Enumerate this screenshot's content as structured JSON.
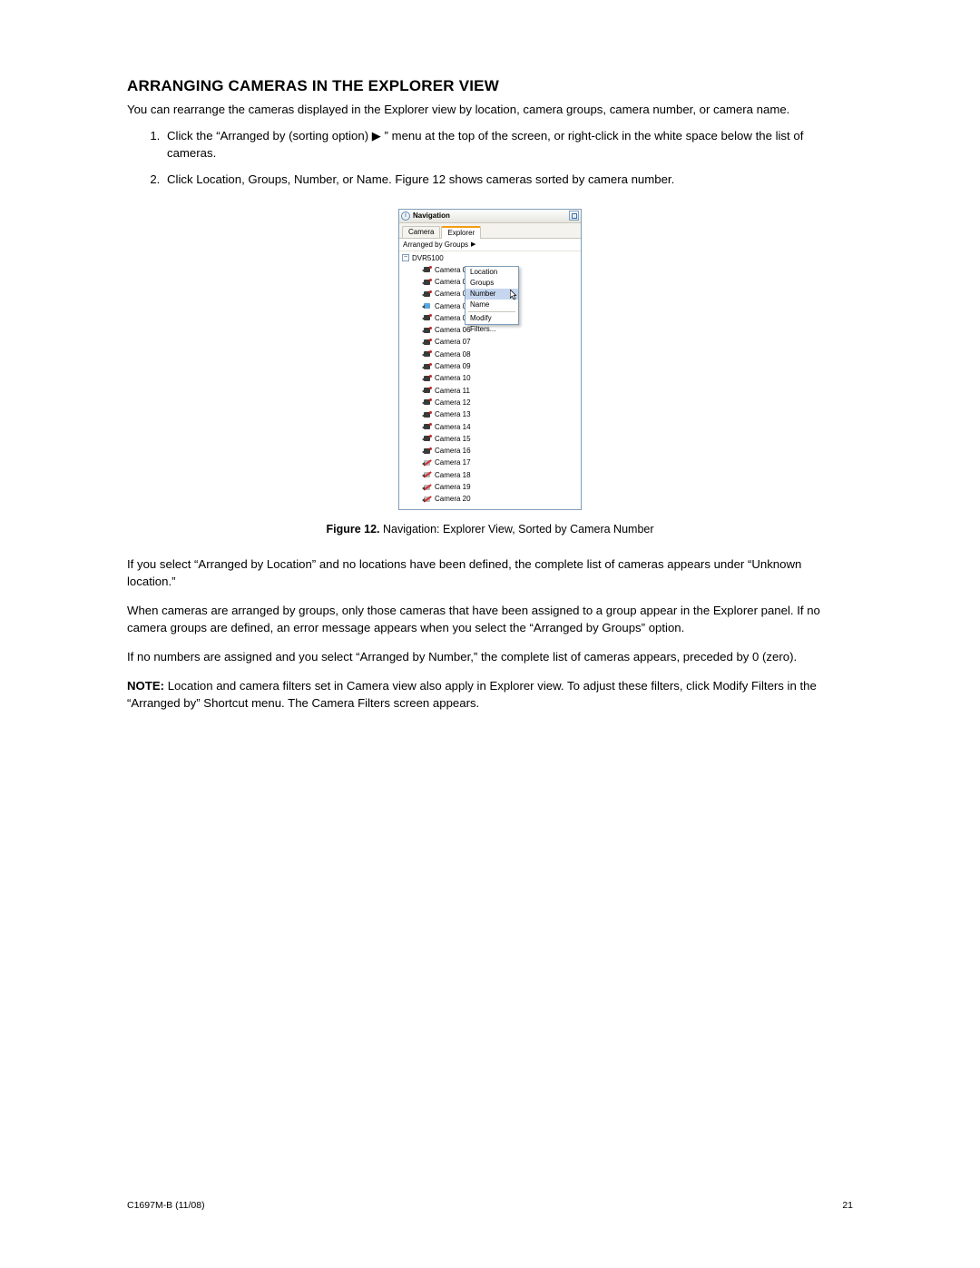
{
  "heading": "ARRANGING CAMERAS IN THE EXPLORER VIEW",
  "intro": "You can rearrange the cameras displayed in the Explorer view by location, camera groups, camera number, or camera name.",
  "steps": [
    "Click the “Arranged by  (sorting option) ▶ ” menu at the top of the screen, or right-click in the white space below the list of cameras.",
    "Click Location, Groups, Number, or Name. Figure 12 shows cameras sorted by camera number."
  ],
  "panel": {
    "title": "Navigation",
    "tabs": {
      "camera": "Camera",
      "explorer": "Explorer"
    },
    "arranged_label": "Arranged by Groups",
    "root": "DVR5100",
    "cameras": [
      {
        "label": "Camera 01",
        "state": "on"
      },
      {
        "label": "Camera 02",
        "state": "on"
      },
      {
        "label": "Camera 03",
        "state": "on"
      },
      {
        "label": "Camera 04",
        "state": "sel"
      },
      {
        "label": "Camera 05",
        "state": "on"
      },
      {
        "label": "Camera 06",
        "state": "on"
      },
      {
        "label": "Camera 07",
        "state": "on"
      },
      {
        "label": "Camera 08",
        "state": "on"
      },
      {
        "label": "Camera 09",
        "state": "on"
      },
      {
        "label": "Camera 10",
        "state": "on"
      },
      {
        "label": "Camera 11",
        "state": "on"
      },
      {
        "label": "Camera 12",
        "state": "on"
      },
      {
        "label": "Camera 13",
        "state": "on"
      },
      {
        "label": "Camera 14",
        "state": "on"
      },
      {
        "label": "Camera 15",
        "state": "on"
      },
      {
        "label": "Camera 16",
        "state": "on"
      },
      {
        "label": "Camera 17",
        "state": "off"
      },
      {
        "label": "Camera 18",
        "state": "off"
      },
      {
        "label": "Camera 19",
        "state": "off"
      },
      {
        "label": "Camera 20",
        "state": "off"
      }
    ],
    "menu": {
      "location": "Location",
      "groups": "Groups",
      "number": "Number",
      "name": "Name",
      "modify": "Modify Filters..."
    }
  },
  "caption": {
    "bold": "Figure 12.",
    "rest": "  Navigation: Explorer View, Sorted by Camera Number"
  },
  "paragraphs": [
    "If you select “Arranged by Location” and no locations have been defined, the complete list of cameras appears under “Unknown location.”",
    "When cameras are arranged by groups, only those cameras that have been assigned to a group appear in the Explorer panel. If no camera groups are defined, an error message appears when you select the “Arranged by Groups” option.",
    "If no numbers are assigned and you select “Arranged by Number,” the complete list of cameras appears, preceded by 0 (zero)."
  ],
  "note": {
    "label": "NOTE:",
    "text": "  Location and camera filters set in Camera view also apply in Explorer view. To adjust these filters, click Modify Filters in the “Arranged by” Shortcut menu. The Camera Filters screen appears."
  },
  "footer": {
    "doc": "C1697M-B (11/08)",
    "page": "21"
  }
}
